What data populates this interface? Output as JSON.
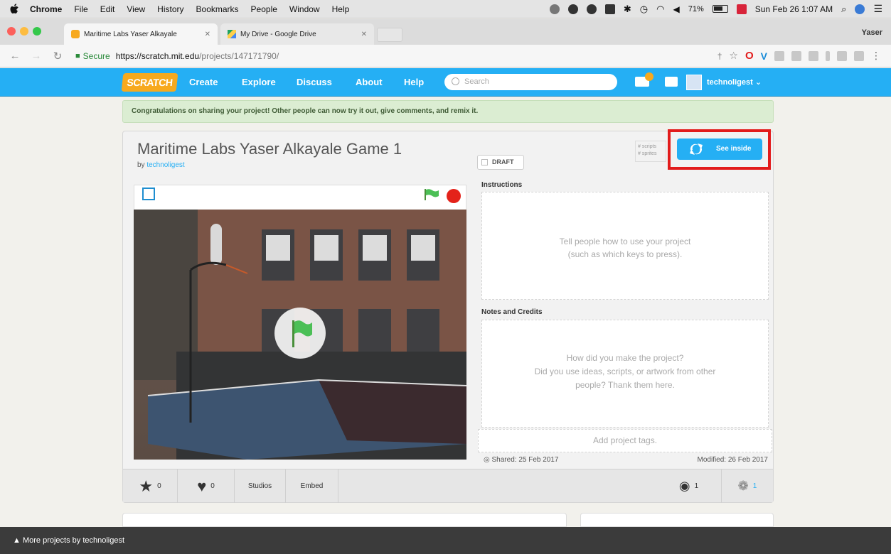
{
  "menubar": {
    "app": "Chrome",
    "items": [
      "File",
      "Edit",
      "View",
      "History",
      "Bookmarks",
      "People",
      "Window",
      "Help"
    ],
    "battery": "71%",
    "clock": "Sun Feb 26  1:07 AM"
  },
  "tabs": [
    {
      "title": "Maritime Labs Yaser Alkayale",
      "active": true
    },
    {
      "title": "My Drive - Google Drive",
      "active": false
    }
  ],
  "profile": "Yaser",
  "address": {
    "secure_label": "Secure",
    "url_host": "https://scratch.mit.edu",
    "url_path": "/projects/147171790/"
  },
  "nav": {
    "logo": "SCRATCH",
    "links": [
      "Create",
      "Explore",
      "Discuss",
      "About",
      "Help"
    ],
    "search_placeholder": "Search",
    "username": "technoligest"
  },
  "banner": "Congratulations on sharing your project! Other people can now try it out, give comments, and remix it.",
  "project": {
    "title": "Maritime Labs Yaser Alkayale Game 1",
    "by_prefix": "by",
    "author": "technoligest",
    "draft_label": "DRAFT",
    "counts_line1": "# scripts",
    "counts_line2": "# sprites",
    "see_inside": "See inside"
  },
  "instructions": {
    "label": "Instructions",
    "placeholder_line1": "Tell people how to use your project",
    "placeholder_line2": "(such as which keys to press)."
  },
  "notes": {
    "label": "Notes and Credits",
    "placeholder_line1": "How did you make the project?",
    "placeholder_line2": "Did you use ideas, scripts, or artwork from other",
    "placeholder_line3": "people? Thank them here."
  },
  "tags_placeholder": "Add project tags.",
  "shared": "Shared: 25 Feb 2017",
  "modified": "Modified: 26 Feb 2017",
  "actions": {
    "favorites": "0",
    "loves": "0",
    "studios": "Studios",
    "embed": "Embed",
    "views": "1",
    "remixes": "1"
  },
  "more_projects": "More projects by technoligest",
  "colors": {
    "scratch_blue": "#25aff4",
    "highlight_red": "#e21b1b",
    "logo_orange": "#f7a91e"
  }
}
